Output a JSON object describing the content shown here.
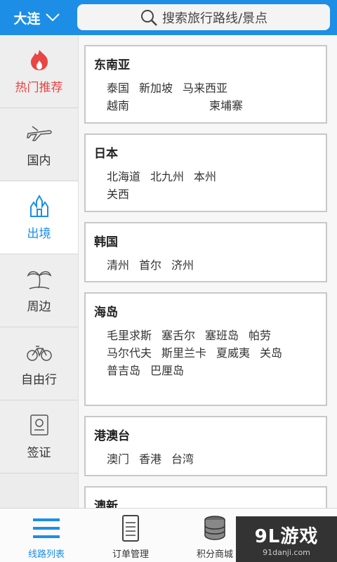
{
  "header": {
    "city": "大连",
    "search_placeholder": "搜索旅行路线/景点"
  },
  "sidebar": {
    "items": [
      {
        "label": "热门推荐",
        "icon": "flame-icon"
      },
      {
        "label": "国内",
        "icon": "airplane-icon"
      },
      {
        "label": "出境",
        "icon": "castle-icon"
      },
      {
        "label": "周边",
        "icon": "palm-tree-icon"
      },
      {
        "label": "自由行",
        "icon": "bicycle-icon"
      },
      {
        "label": "签证",
        "icon": "passport-icon"
      }
    ],
    "active_index": 2
  },
  "sections": [
    {
      "title": "东南亚",
      "places": [
        "泰国",
        "新加坡",
        "马来西亚",
        "越南",
        "柬埔寨"
      ]
    },
    {
      "title": "日本",
      "places": [
        "北海道",
        "北九州",
        "本州",
        "关西"
      ]
    },
    {
      "title": "韩国",
      "places": [
        "清州",
        "首尔",
        "济州"
      ]
    },
    {
      "title": "海岛",
      "places": [
        "毛里求斯",
        "塞舌尔",
        "塞班岛",
        "帕劳",
        "马尔代夫",
        "斯里兰卡",
        "夏威夷",
        "关岛",
        "普吉岛",
        "巴厘岛"
      ]
    },
    {
      "title": "港澳台",
      "places": [
        "澳门",
        "香港",
        "台湾"
      ]
    },
    {
      "title": "澳新",
      "places": []
    }
  ],
  "tabbar": {
    "tabs": [
      {
        "label": "线路列表",
        "icon": "list-icon"
      },
      {
        "label": "订单管理",
        "icon": "order-icon"
      },
      {
        "label": "积分商城",
        "icon": "coins-icon"
      },
      {
        "label": "",
        "icon": "search-icon"
      }
    ]
  },
  "watermark": {
    "logo": "9L游戏",
    "site": "91danji.com"
  },
  "colors": {
    "primary": "#1c8ee6",
    "hot": "#e84545"
  }
}
